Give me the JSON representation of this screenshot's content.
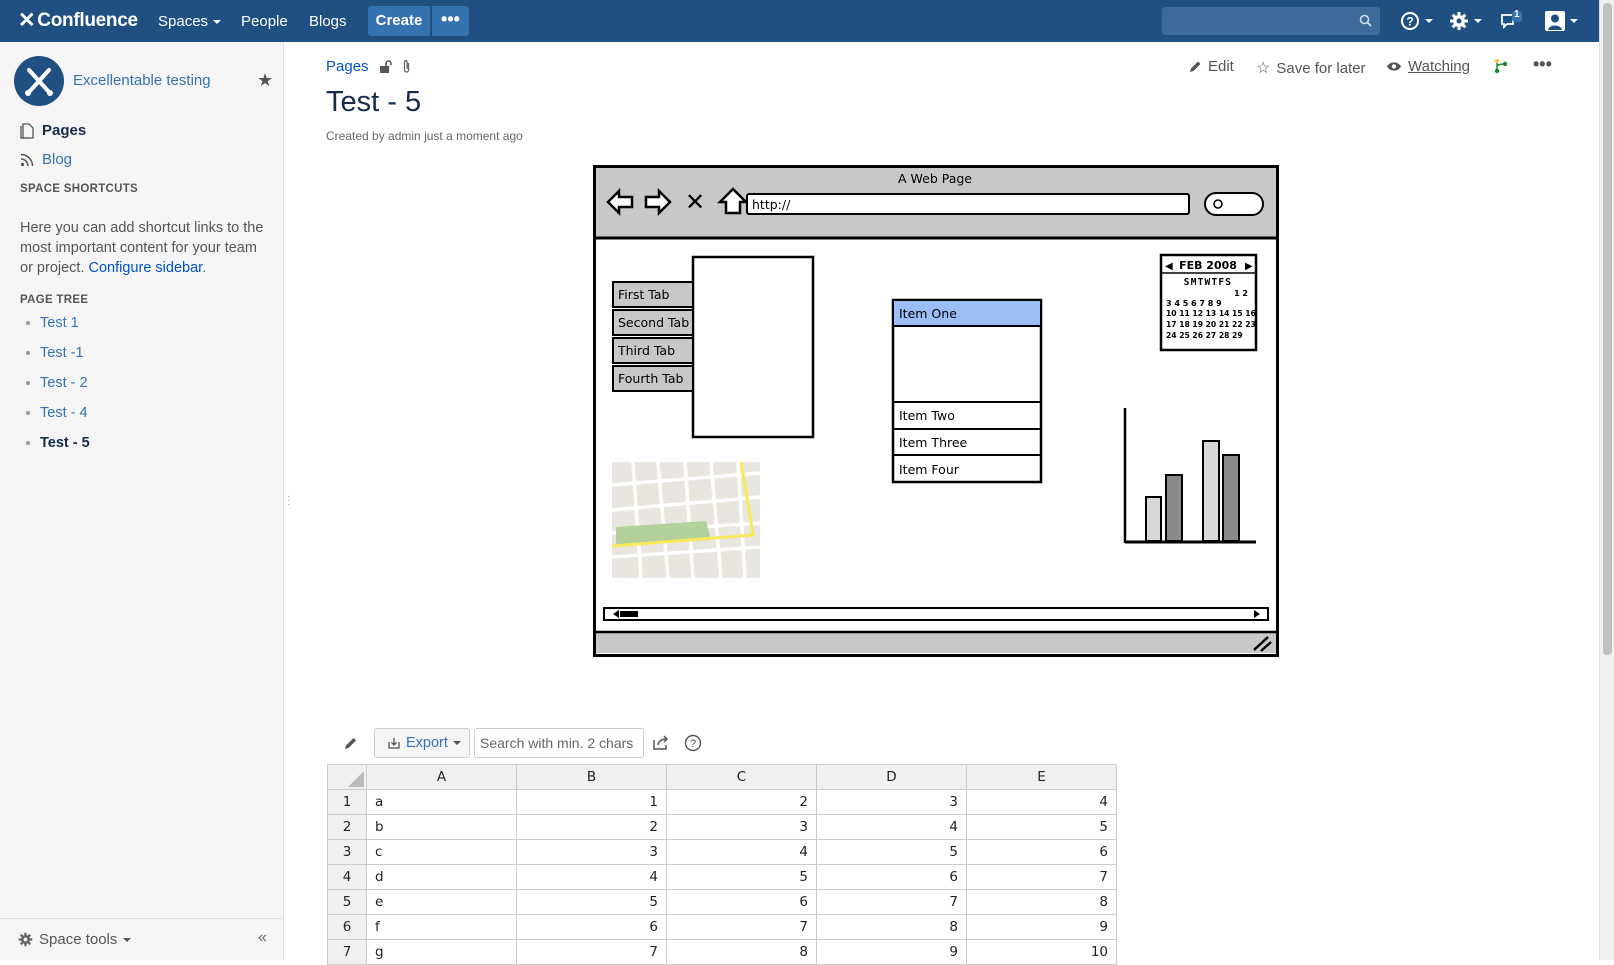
{
  "topbar": {
    "logo": "Confluence",
    "nav": [
      "Spaces",
      "People",
      "Blogs"
    ],
    "create_label": "Create",
    "more_label": "•••",
    "notification_count": "1"
  },
  "sidebar": {
    "space_name": "Excellentable testing",
    "pages_label": "Pages",
    "blog_label": "Blog",
    "shortcuts_heading": "SPACE SHORTCUTS",
    "shortcut_text": "Here you can add shortcut links to the most important content for your team or project.",
    "configure_link": "Configure sidebar",
    "page_tree_heading": "PAGE TREE",
    "tree": [
      "Test 1",
      "Test -1",
      "Test - 2",
      "Test - 4",
      "Test - 5"
    ],
    "space_tools": "Space tools"
  },
  "page": {
    "breadcrumb": "Pages",
    "actions": {
      "edit": "Edit",
      "save_for_later": "Save for later",
      "watching": "Watching"
    },
    "title": "Test - 5",
    "byline_prefix": "Created by",
    "byline_author": "admin",
    "byline_suffix": "just a moment ago"
  },
  "mockup": {
    "window_title": "A Web Page",
    "url": "http://",
    "tabs": [
      "First Tab",
      "Second Tab",
      "Third Tab",
      "Fourth Tab"
    ],
    "list_items": [
      "Item One",
      "Item Two",
      "Item Three",
      "Item Four"
    ],
    "calendar_title": "FEB 2008",
    "calendar_days": "SMTWTFS",
    "calendar_rows": [
      "1 2",
      "3 4 5 6 7 8 9",
      "10 11 12 13 14 15 16",
      "17 18 19 20 21 22 23",
      "24 25 26 27 28 29"
    ]
  },
  "table": {
    "export_label": "Export",
    "search_placeholder": "Search with min. 2 chars",
    "columns": [
      "A",
      "B",
      "C",
      "D",
      "E"
    ],
    "rows": [
      {
        "n": "1",
        "a": "a",
        "b": "1",
        "c": "2",
        "d": "3",
        "e": "4"
      },
      {
        "n": "2",
        "a": "b",
        "b": "2",
        "c": "3",
        "d": "4",
        "e": "5"
      },
      {
        "n": "3",
        "a": "c",
        "b": "3",
        "c": "4",
        "d": "5",
        "e": "6"
      },
      {
        "n": "4",
        "a": "d",
        "b": "4",
        "c": "5",
        "d": "6",
        "e": "7"
      },
      {
        "n": "5",
        "a": "e",
        "b": "5",
        "c": "6",
        "d": "7",
        "e": "8"
      },
      {
        "n": "6",
        "a": "f",
        "b": "6",
        "c": "7",
        "d": "8",
        "e": "9"
      },
      {
        "n": "7",
        "a": "g",
        "b": "7",
        "c": "8",
        "d": "9",
        "e": "10"
      }
    ]
  },
  "colors": {
    "header": "#205081",
    "create": "#3572b0",
    "link": "#3572b0",
    "list_highlight": "#9bbdf5"
  }
}
